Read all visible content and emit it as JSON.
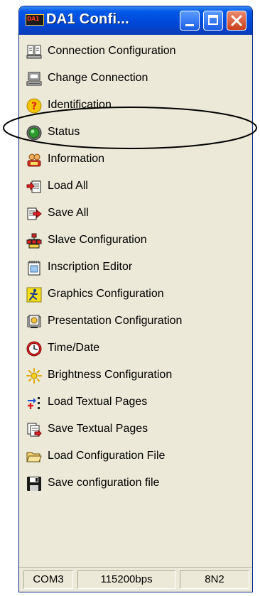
{
  "window": {
    "title": "DA1 Confi...",
    "app_icon_text": "DA1"
  },
  "menu": [
    {
      "label": "Connection Configuration",
      "icon": "connection-config-icon"
    },
    {
      "label": "Change Connection",
      "icon": "computer-icon"
    },
    {
      "label": "Identification",
      "icon": "help-icon"
    },
    {
      "label": "Status",
      "icon": "status-icon"
    },
    {
      "label": "Information",
      "icon": "information-icon"
    },
    {
      "label": "Load All",
      "icon": "load-all-icon"
    },
    {
      "label": "Save All",
      "icon": "save-all-icon"
    },
    {
      "label": "Slave Configuration",
      "icon": "slave-config-icon"
    },
    {
      "label": "Inscription Editor",
      "icon": "inscription-editor-icon"
    },
    {
      "label": "Graphics Configuration",
      "icon": "graphics-config-icon"
    },
    {
      "label": "Presentation Configuration",
      "icon": "presentation-config-icon"
    },
    {
      "label": "Time/Date",
      "icon": "clock-icon"
    },
    {
      "label": "Brightness Configuration",
      "icon": "sun-icon"
    },
    {
      "label": "Load Textual Pages",
      "icon": "load-textual-pages-icon"
    },
    {
      "label": "Save Textual Pages",
      "icon": "save-textual-pages-icon"
    },
    {
      "label": "Load Configuration File",
      "icon": "folder-open-icon"
    },
    {
      "label": "Save configuration file",
      "icon": "floppy-disk-icon"
    }
  ],
  "status": {
    "port": "COM3",
    "baud": "115200bps",
    "format": "8N2"
  },
  "colors": {
    "titlebar": "#0047d6",
    "window_bg": "#ece9d8",
    "close_button": "#c9401c"
  }
}
